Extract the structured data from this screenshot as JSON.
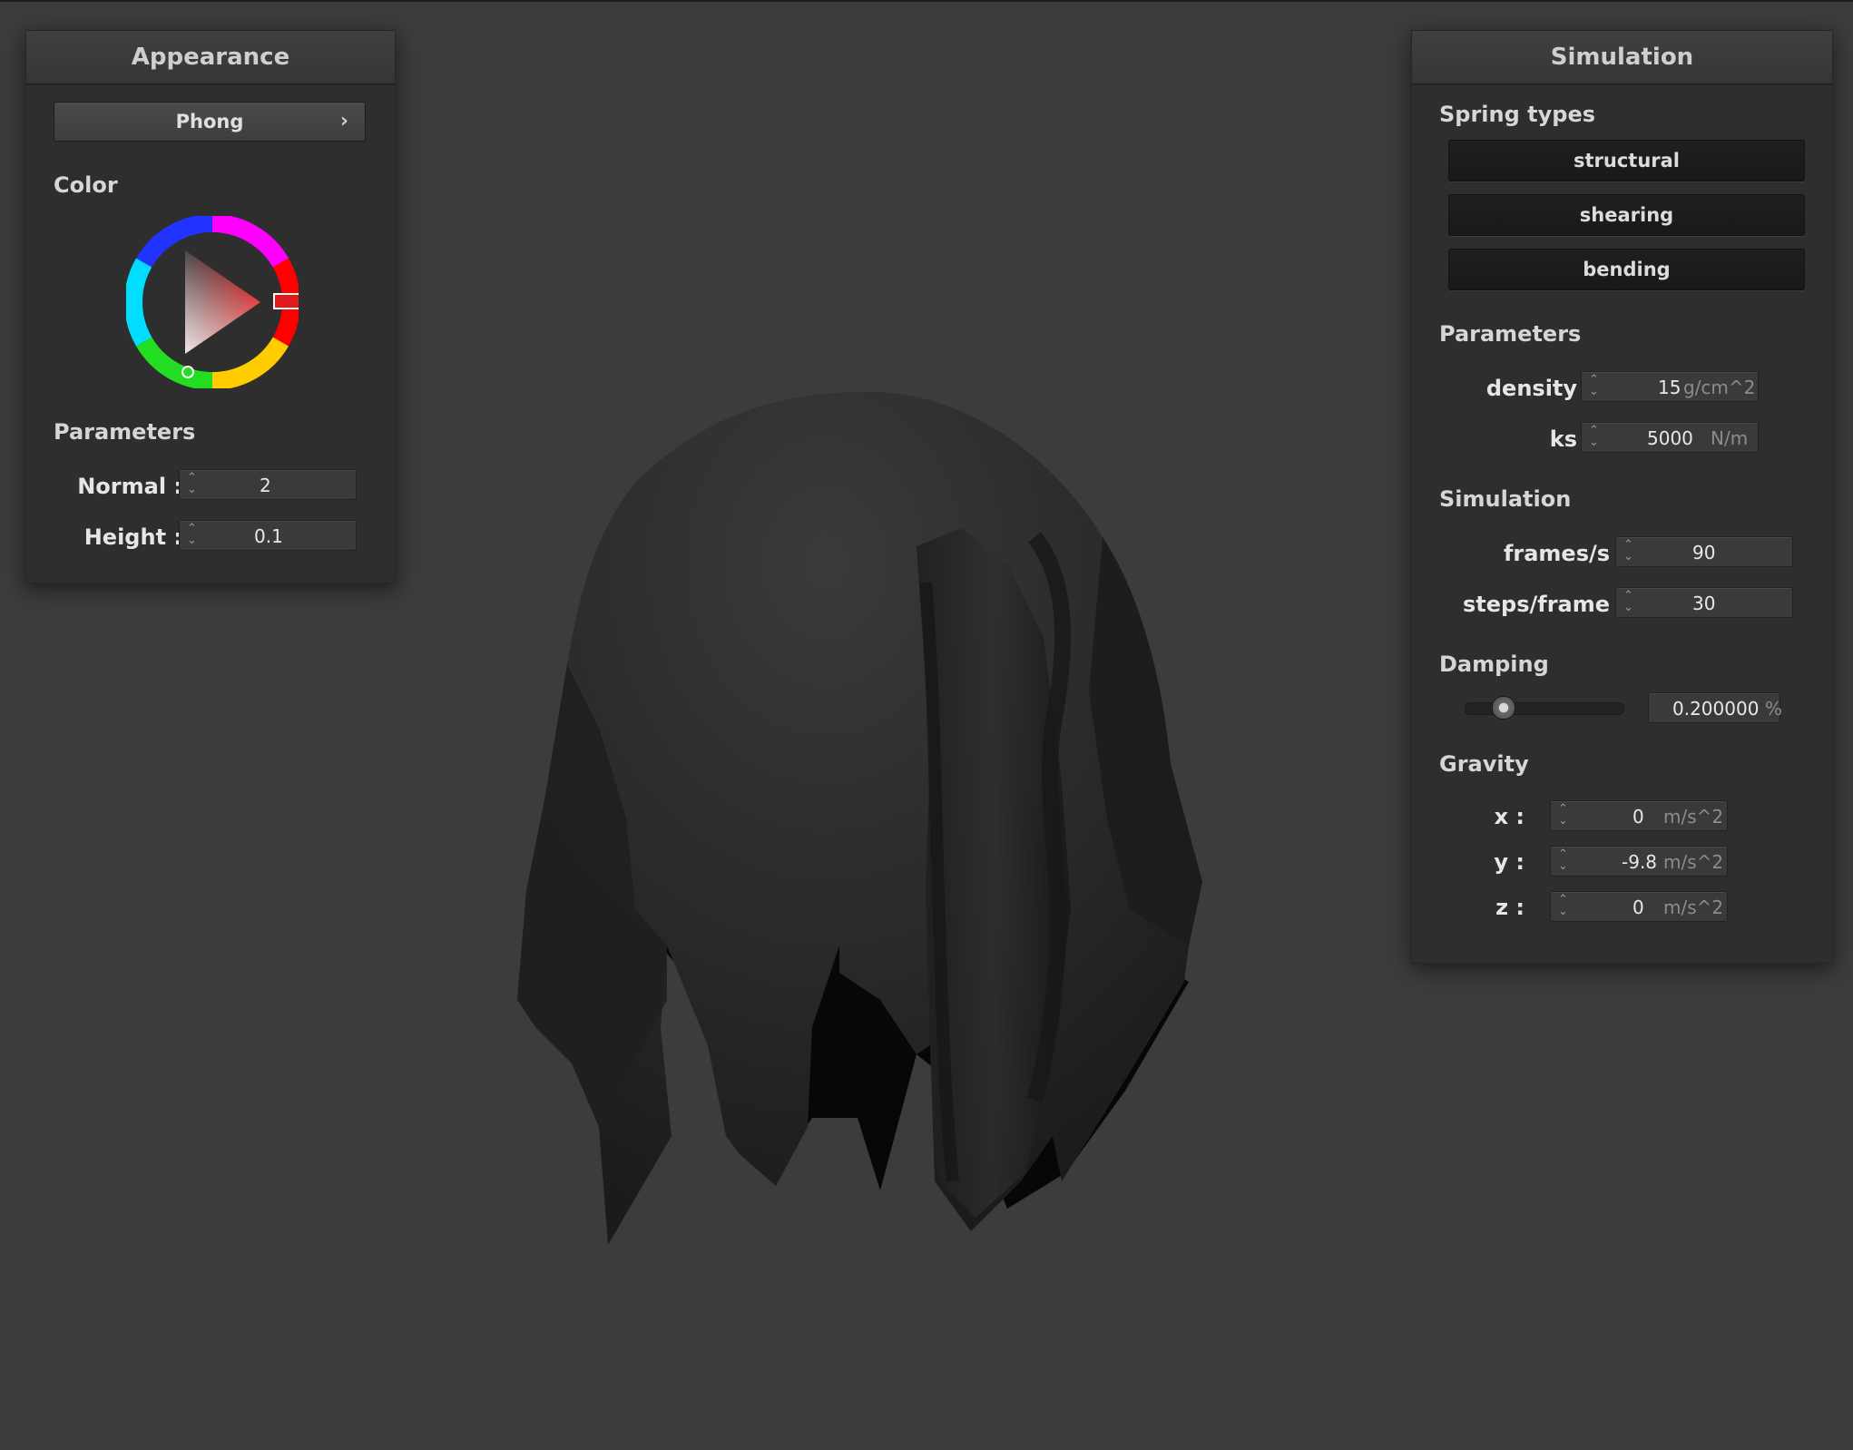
{
  "appearance": {
    "title": "Appearance",
    "shader_label": "Phong",
    "color_title": "Color",
    "parameters_title": "Parameters",
    "normal": {
      "label": "Normal :",
      "value": "2"
    },
    "height": {
      "label": "Height :",
      "value": "0.1"
    },
    "selected_color": "#e01a1a"
  },
  "simulation": {
    "title": "Simulation",
    "spring_types_title": "Spring types",
    "spring_types": [
      "structural",
      "shearing",
      "bending"
    ],
    "parameters_title": "Parameters",
    "density": {
      "label": "density :",
      "value": "15",
      "unit": "g/cm^2"
    },
    "ks": {
      "label": "ks :",
      "value": "5000",
      "unit": "N/m"
    },
    "simulation_title": "Simulation",
    "frames": {
      "label": "frames/s :",
      "value": "90"
    },
    "steps": {
      "label": "steps/frame :",
      "value": "30"
    },
    "damping_title": "Damping",
    "damping": {
      "value": "0.200000",
      "unit": "%",
      "fraction": 0.2
    },
    "gravity_title": "Gravity",
    "gravity": [
      {
        "label": "x :",
        "value": "0",
        "unit": "m/s^2"
      },
      {
        "label": "y :",
        "value": "-9.8",
        "unit": "m/s^2"
      },
      {
        "label": "z :",
        "value": "0",
        "unit": "m/s^2"
      }
    ]
  }
}
